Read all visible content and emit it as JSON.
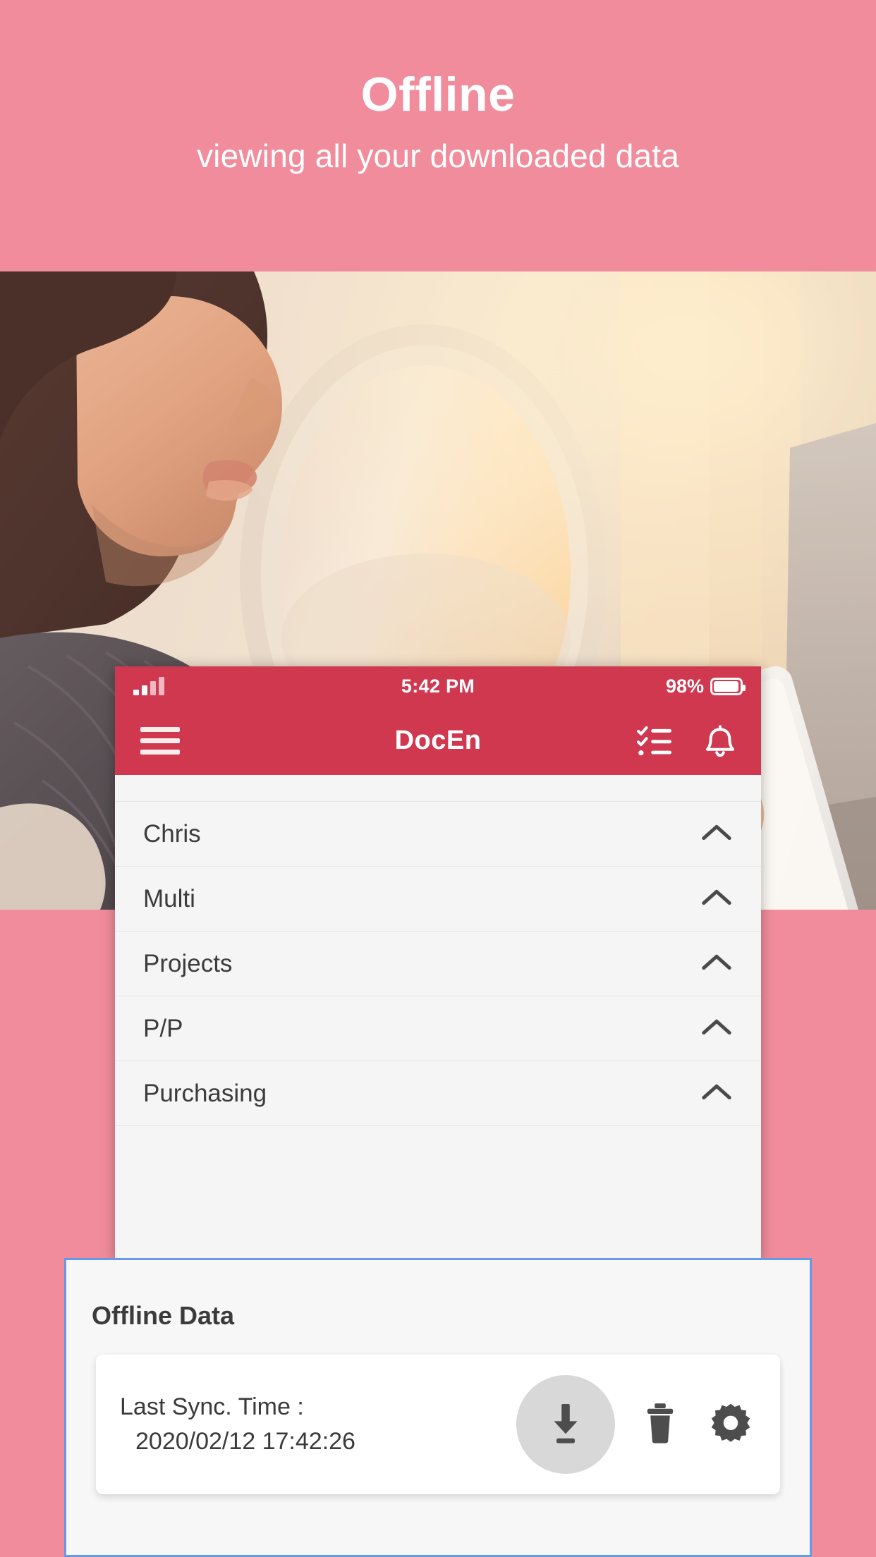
{
  "promo": {
    "title": "Offline",
    "subtitle": "viewing all your downloaded data",
    "background_color": "#F18C9C",
    "text_color": "#FFFFFF"
  },
  "photo": {
    "alt": "woman in airplane seat looking at smartphone next to window",
    "name": "airplane-passenger-photo"
  },
  "phone": {
    "status_bar": {
      "signal_icon": "signal-bars-icon",
      "time": "5:42 PM",
      "battery_percent": "98%",
      "battery_icon": "battery-icon",
      "background_color": "#D0384F"
    },
    "app_bar": {
      "menu_icon": "hamburger-menu-icon",
      "title": "DocEn",
      "actions": [
        {
          "icon": "checklist-icon"
        },
        {
          "icon": "bell-icon"
        }
      ],
      "background_color": "#D0384F"
    },
    "list": {
      "items": [
        {
          "label": "Chris",
          "chevron": "chevron-up-icon"
        },
        {
          "label": "Multi",
          "chevron": "chevron-up-icon"
        },
        {
          "label": "Projects",
          "chevron": "chevron-up-icon"
        },
        {
          "label": "P/P",
          "chevron": "chevron-up-icon"
        },
        {
          "label": "Purchasing",
          "chevron": "chevron-up-icon"
        }
      ]
    }
  },
  "offline_panel": {
    "title": "Offline Data",
    "border_color": "#6699E8",
    "sync_card": {
      "label": "Last Sync. Time :",
      "value": "2020/02/12 17:42:26",
      "actions": [
        {
          "icon": "download-icon",
          "name": "download-button"
        },
        {
          "icon": "trash-icon",
          "name": "delete-button"
        },
        {
          "icon": "gear-icon",
          "name": "settings-button"
        }
      ]
    }
  }
}
